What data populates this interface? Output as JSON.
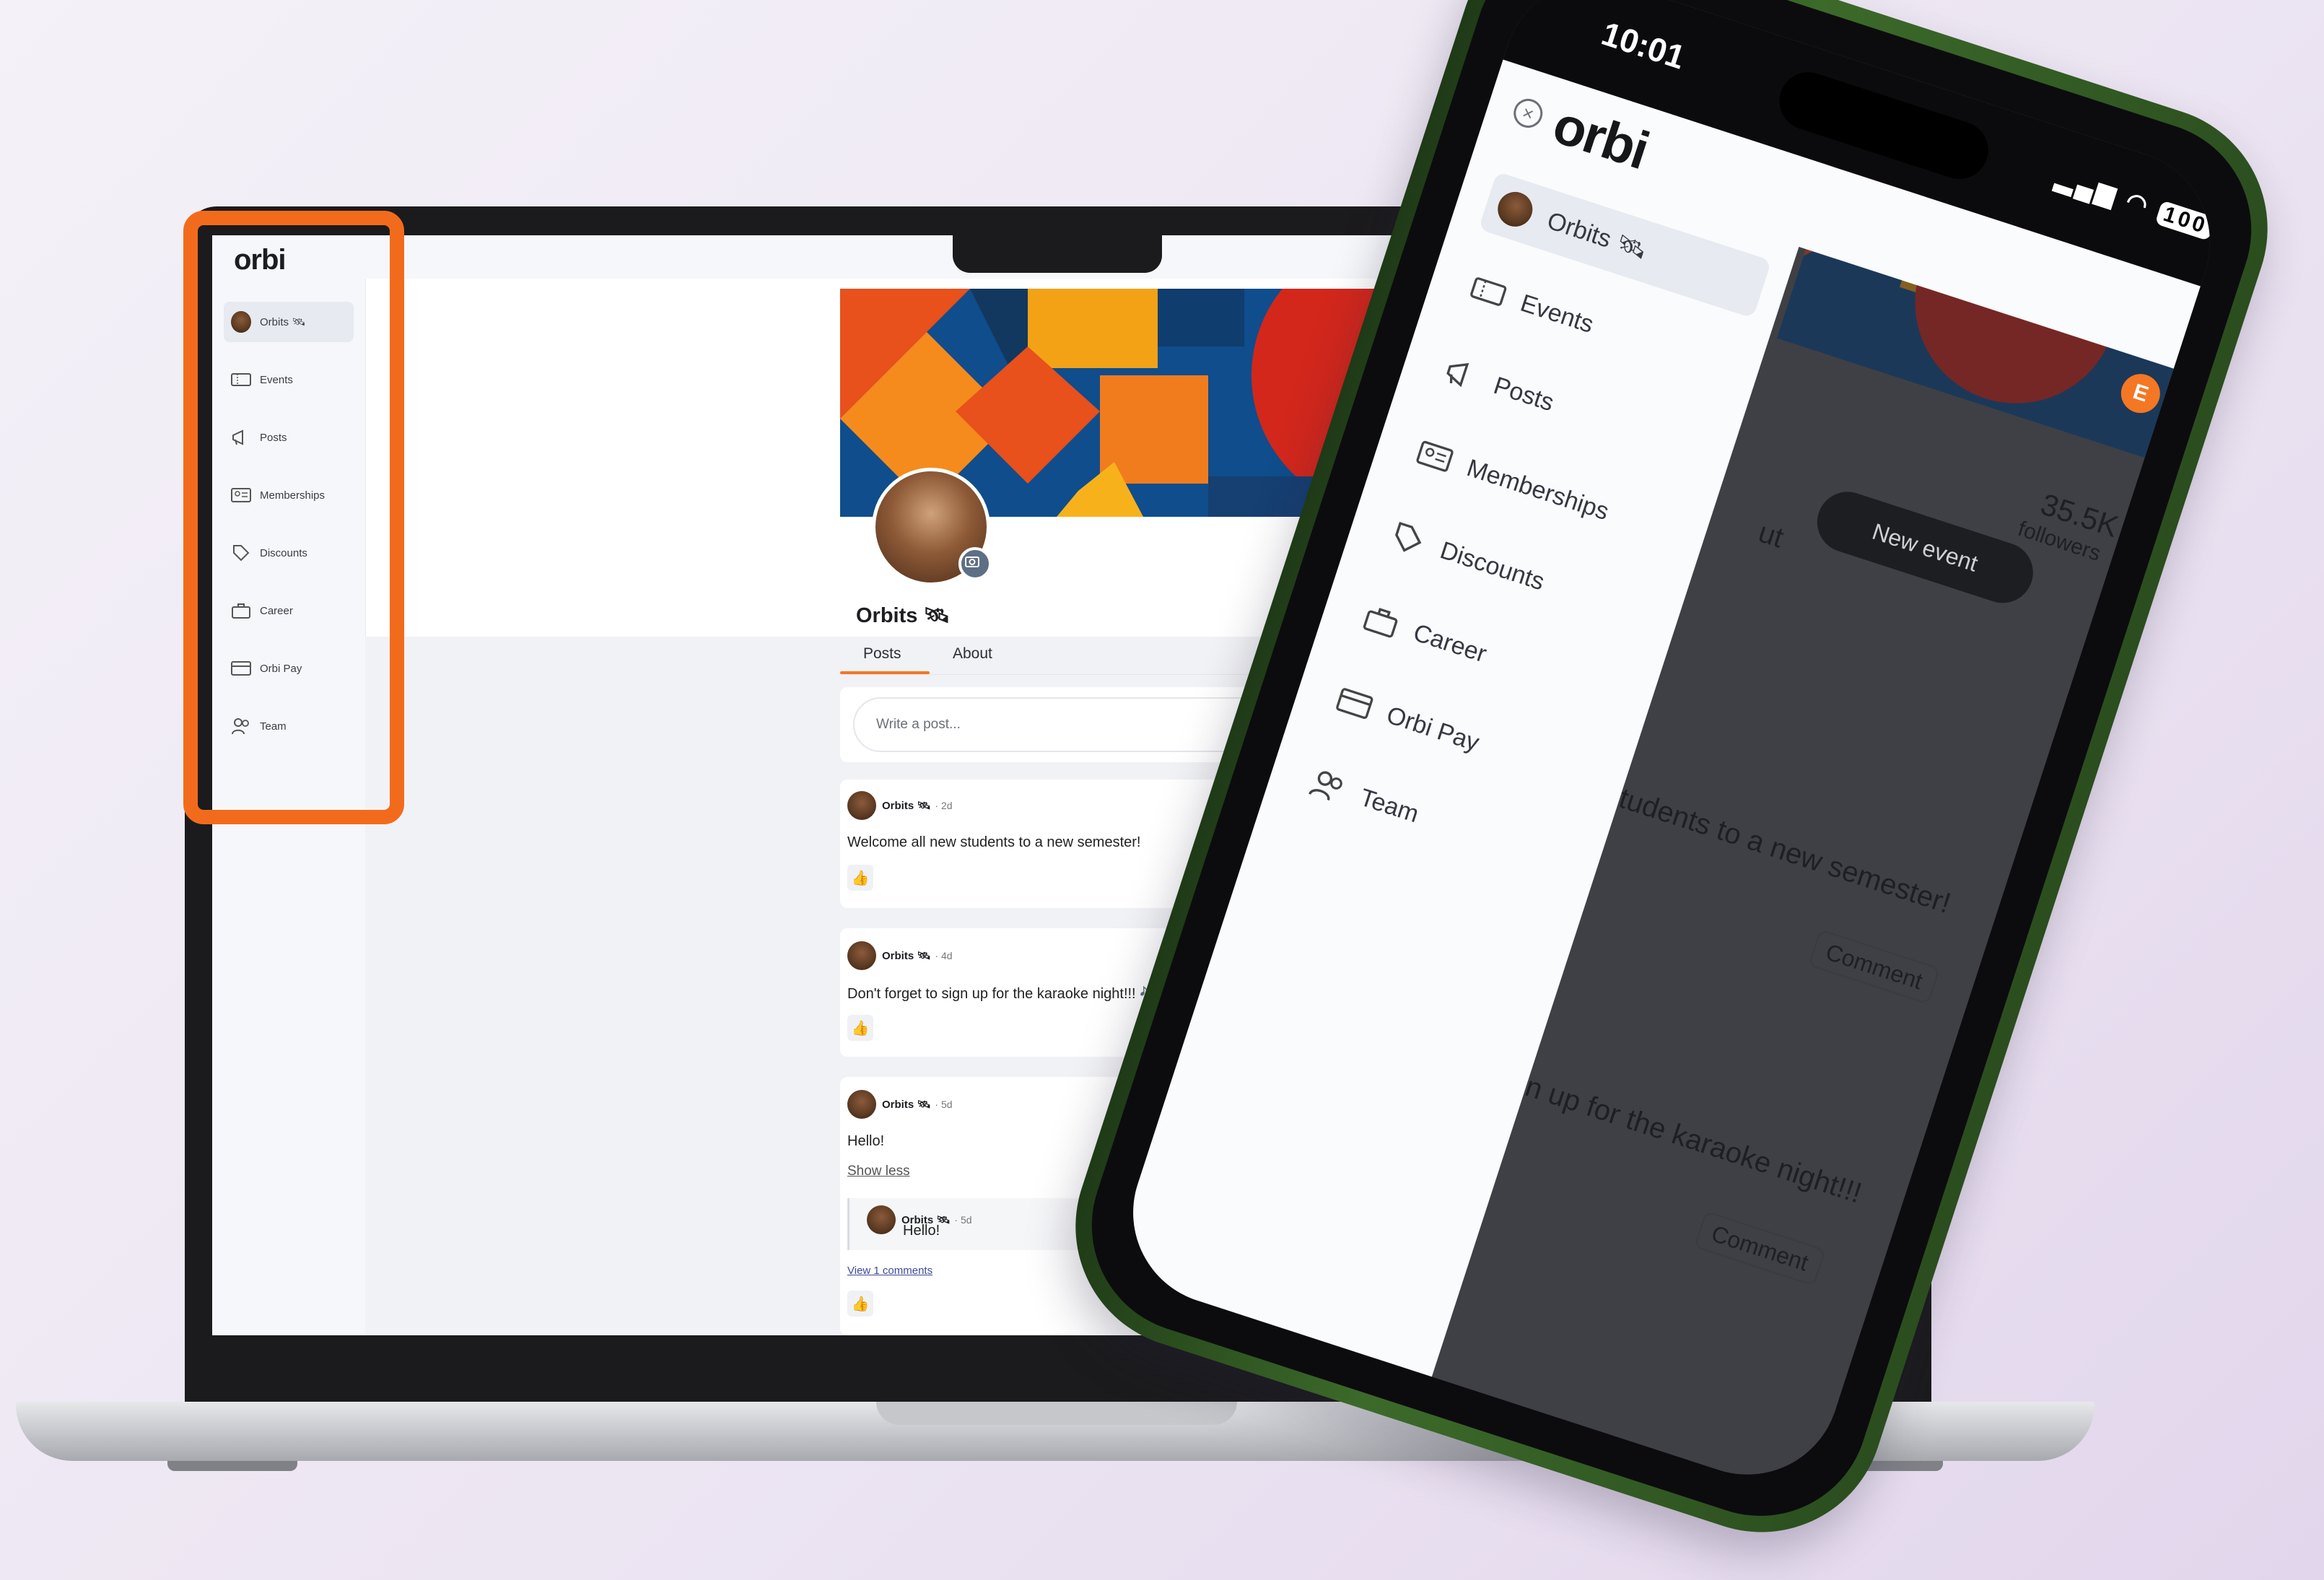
{
  "laptop": {
    "logo": "orbi",
    "nav": [
      {
        "label": "Orbits 🛰",
        "icon": "avatar"
      },
      {
        "label": "Events",
        "icon": "ticket-icon"
      },
      {
        "label": "Posts",
        "icon": "megaphone-icon"
      },
      {
        "label": "Memberships",
        "icon": "id-card-icon"
      },
      {
        "label": "Discounts",
        "icon": "tag-icon"
      },
      {
        "label": "Career",
        "icon": "briefcase-icon"
      },
      {
        "label": "Orbi Pay",
        "icon": "credit-card-icon"
      },
      {
        "label": "Team",
        "icon": "people-icon"
      }
    ],
    "profile": {
      "name": "Orbits 🛰",
      "tabs": [
        "Posts",
        "About"
      ]
    },
    "composer_placeholder": "Write a post...",
    "posts": [
      {
        "author": "Orbits 🛰",
        "time": "· 2d",
        "text": "Welcome all new students to a new semester!",
        "like": "👍"
      },
      {
        "author": "Orbits 🛰",
        "time": "· 4d",
        "text": "Don't forget to sign up for the karaoke night!!! 🎶 🎤",
        "like": "👍"
      },
      {
        "author": "Orbits 🛰",
        "time": "· 5d",
        "text": "Hello!",
        "show_less": "Show less",
        "reply": {
          "author": "Orbits 🛰",
          "time": "· 5d",
          "text": "Hello!"
        },
        "view_comments": "View 1 comments",
        "like": "👍"
      }
    ]
  },
  "phone": {
    "status": {
      "time": "10:01",
      "battery": "100"
    },
    "logo": "orbi",
    "avatar_letter": "E",
    "nav": [
      {
        "label": "Orbits 🛰"
      },
      {
        "label": "Events"
      },
      {
        "label": "Posts"
      },
      {
        "label": "Memberships"
      },
      {
        "label": "Discounts"
      },
      {
        "label": "Career"
      },
      {
        "label": "Orbi Pay"
      },
      {
        "label": "Team"
      }
    ],
    "followers_count": "35.5K",
    "followers_label": "followers",
    "new_event": "New event",
    "tab_partial": "ut",
    "post1_partial": "tudents to a new semester!",
    "post2_partial": "n up for the karaoke night!!!",
    "comment_label": "Comment"
  },
  "colors": {
    "accent": "#f26b1d",
    "brand_dark": "#17171b"
  }
}
